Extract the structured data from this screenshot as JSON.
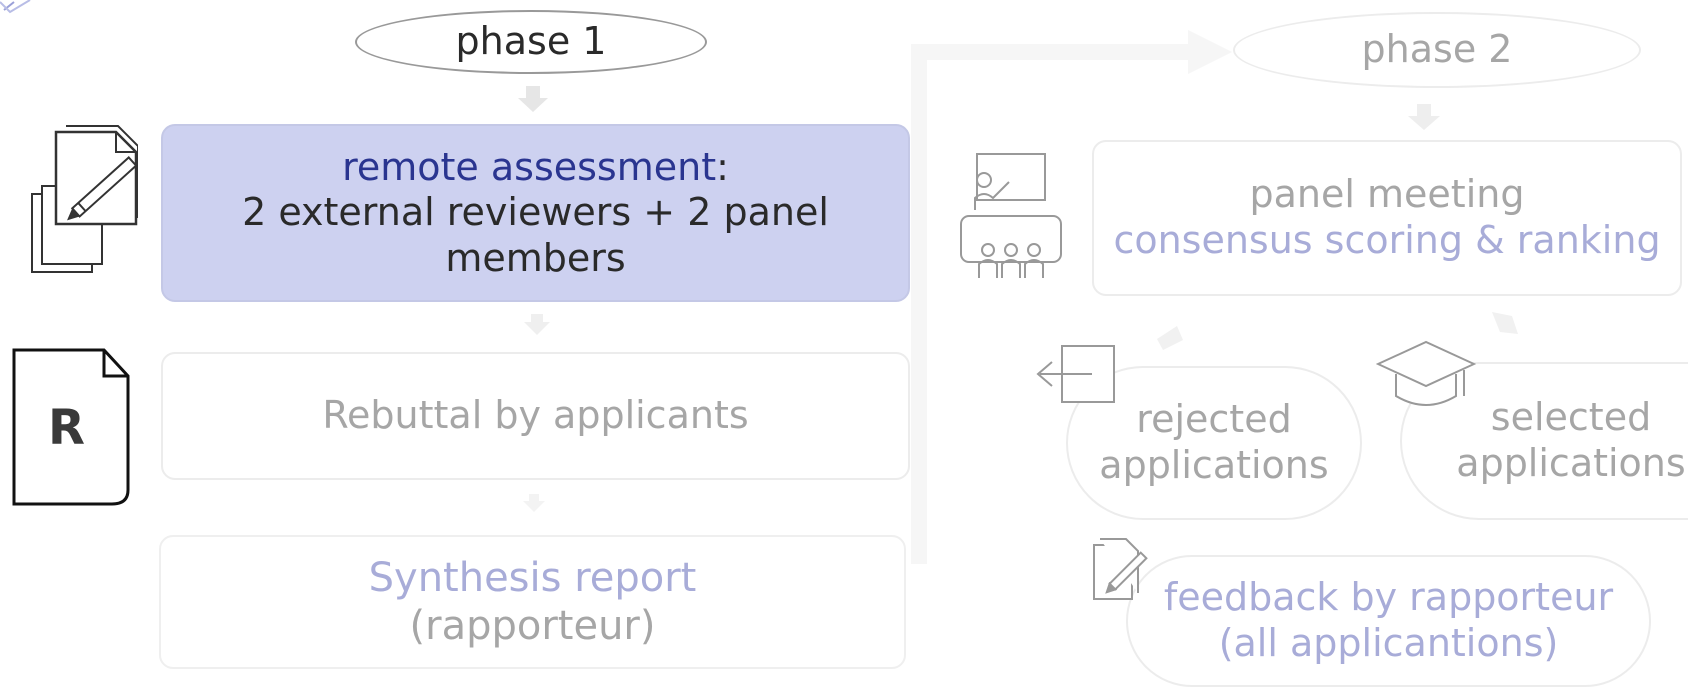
{
  "phase1": {
    "label": "phase 1",
    "step1": {
      "title": "remote assessment",
      "colon": ":",
      "detail": "2 external reviewers + 2 panel members"
    },
    "step2": {
      "text": "Rebuttal by applicants",
      "badge": "R"
    },
    "step3": {
      "title": "Synthesis report",
      "detail": "(rapporteur)"
    }
  },
  "phase2": {
    "label": "phase 2",
    "meeting": {
      "title": "panel meeting",
      "detail": "consensus scoring & ranking"
    },
    "rejected": {
      "line1": "rejected",
      "line2": "applications"
    },
    "selected": {
      "line1": "selected",
      "line2": "applications"
    },
    "feedback": {
      "line1": "feedback by rapporteur",
      "line2": "(all applicantions)"
    }
  },
  "colors": {
    "step1_fill": "#cdd1f0",
    "navy_text": "#2a3590",
    "lavender_text": "#a8acd8",
    "faded_text": "#a6a6a6"
  },
  "icons": [
    "documents-pencil-icon",
    "report-r-icon",
    "presentation-audience-icon",
    "exit-door-icon",
    "graduation-cap-icon",
    "document-pencil-icon",
    "corner-icon"
  ]
}
